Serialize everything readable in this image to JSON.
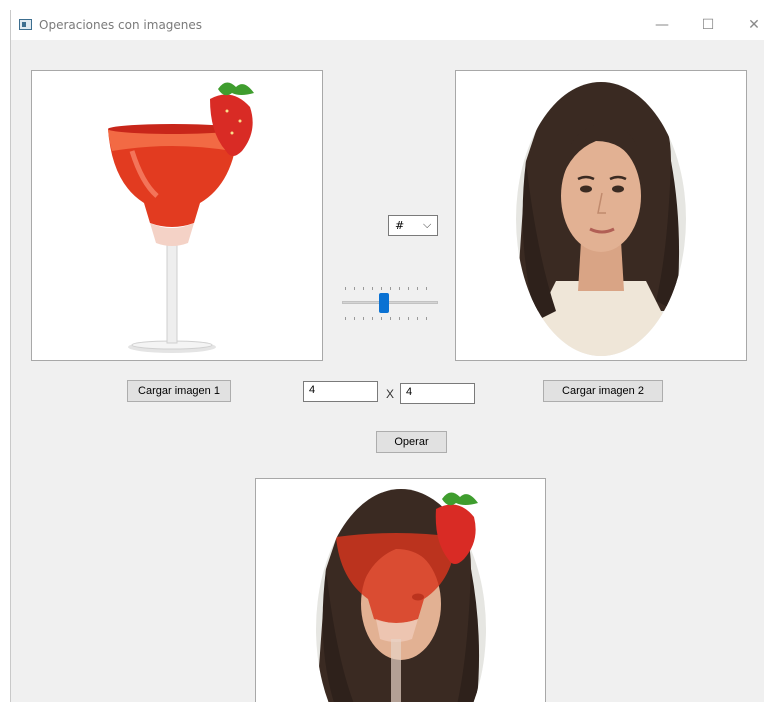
{
  "window": {
    "title": "Operaciones con imagenes",
    "controls": {
      "minimize": "—",
      "maximize": "☐",
      "close": "✕"
    }
  },
  "images": {
    "image1": "margarita-cocktail-with-strawberry",
    "image2": "woman-portrait-in-oval",
    "result": "blended-portrait-and-cocktail"
  },
  "operator": {
    "selected": "#",
    "arrow": "⌵"
  },
  "slider": {
    "value_fraction": 0.43
  },
  "buttons": {
    "load1": "Cargar imagen 1",
    "load2": "Cargar imagen 2",
    "operate": "Operar"
  },
  "size": {
    "width": "4",
    "separator": "X",
    "height": "4"
  },
  "colors": {
    "slider_thumb": "#0a72d3",
    "window_bg": "#f0f0f0"
  }
}
